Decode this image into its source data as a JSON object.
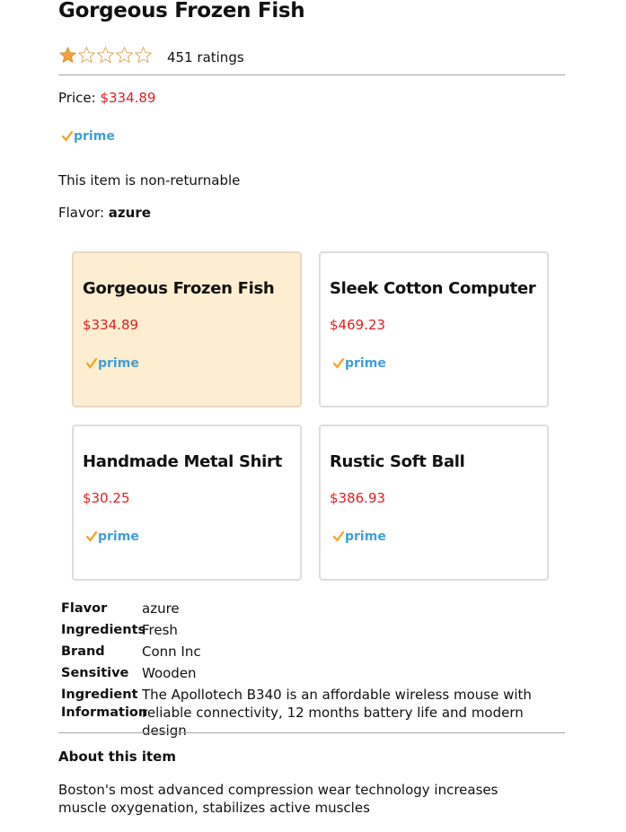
{
  "product": {
    "title": "Gorgeous Frozen Fish",
    "rating_stars": 1,
    "rating_max": 5,
    "ratings_count": "451 ratings",
    "price_label": "Price:",
    "price": "$334.89",
    "prime_label": "prime",
    "returnable_note": "This item is non-returnable",
    "flavor_label": "Flavor:",
    "flavor_value": "azure"
  },
  "variants": [
    {
      "title": "Gorgeous Frozen Fish",
      "price": "$334.89",
      "prime_label": "prime",
      "selected": true
    },
    {
      "title": "Sleek Cotton Computer",
      "price": "$469.23",
      "prime_label": "prime",
      "selected": false
    },
    {
      "title": "Handmade Metal Shirt",
      "price": "$30.25",
      "prime_label": "prime",
      "selected": false
    },
    {
      "title": "Rustic Soft Ball",
      "price": "$386.93",
      "prime_label": "prime",
      "selected": false
    }
  ],
  "specs": [
    {
      "key": "Flavor",
      "value": "azure"
    },
    {
      "key": "Ingredients",
      "value": "Fresh"
    },
    {
      "key": "Brand",
      "value": "Conn Inc"
    },
    {
      "key": "Sensitive",
      "value": "Wooden"
    },
    {
      "key": "Ingredient Information",
      "value": "The Apollotech B340 is an affordable wireless mouse with reliable connectivity, 12 months battery life and modern design"
    }
  ],
  "about": {
    "heading": "About this item",
    "text": "Boston's most advanced compression wear technology increases muscle oxygenation, stabilizes active muscles"
  },
  "colors": {
    "price_red": "#e01f1f",
    "star_orange": "#f0a33a",
    "prime_blue": "#3f9fd6",
    "prime_check": "#f6a21d",
    "selected_bg": "#fdeed1"
  }
}
